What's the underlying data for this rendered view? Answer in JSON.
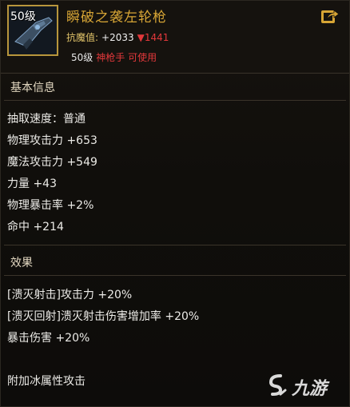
{
  "item": {
    "level_badge": "50级",
    "title": "瞬破之袭左轮枪",
    "resist_label": "抗魔值:",
    "resist_value": "+2033",
    "resist_delta": "1441",
    "required_level": "50级",
    "required_class": "神枪手 可使用"
  },
  "basic_info": {
    "heading": "基本信息",
    "stats": [
      "抽取速度：普通",
      "物理攻击力 +653",
      "魔法攻击力 +549",
      "力量 +43",
      "物理暴击率 +2%",
      "命中 +214"
    ]
  },
  "effects": {
    "heading": "效果",
    "lines": [
      "[溃灭射击]攻击力 +20%",
      "[溃灭回射]溃灭射击伤害增加率 +20%",
      "暴击伤害 +20%"
    ],
    "extra": "附加冰属性攻击"
  },
  "watermark": {
    "text": "九游"
  },
  "colors": {
    "title_gold": "#d7a535",
    "red": "#e2383b",
    "frame_gold": "#b8963c"
  },
  "icons": [
    "revolver-weapon-icon",
    "share-icon",
    "down-arrow-icon",
    "watermark-logo-icon"
  ]
}
